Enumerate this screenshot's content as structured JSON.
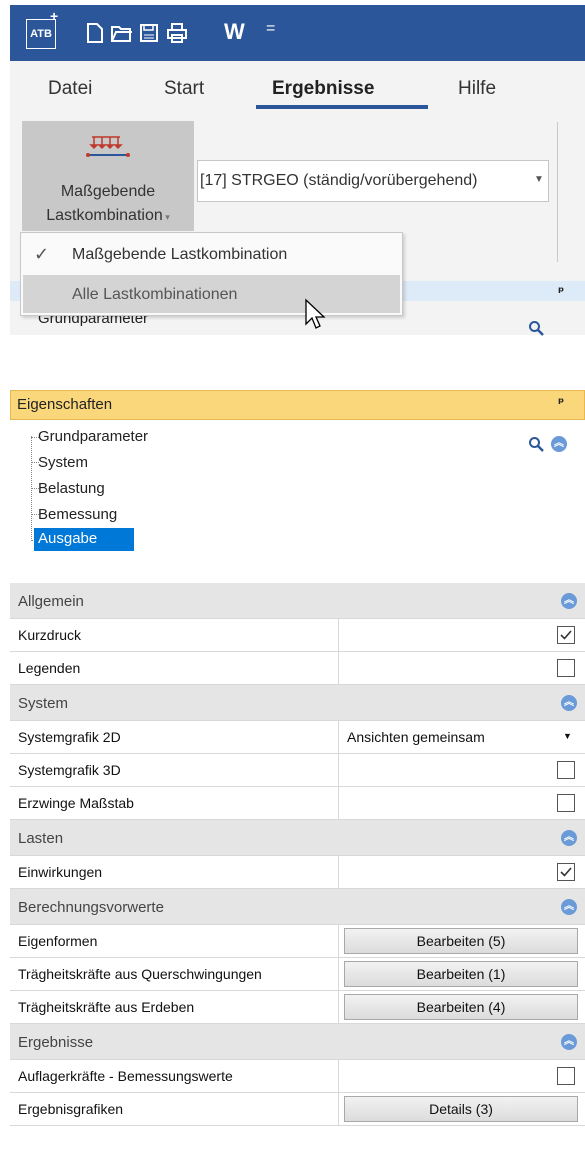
{
  "titlebar": {
    "logo": "ATB",
    "logo_plus": "+",
    "w_label": "W",
    "more": "="
  },
  "ribbon": {
    "tabs": [
      "Datei",
      "Start",
      "Ergebnisse",
      "Hilfe"
    ],
    "active_tab": "Ergebnisse",
    "big_button": {
      "line1": "Maßgebende",
      "line2": "Lastkombination"
    },
    "combo_value": "[17] STRGEO (ständig/vorübergehend)",
    "menu": {
      "items": [
        "Maßgebende Lastkombination",
        "Alle Lastkombinationen"
      ],
      "checked": "Maßgebende Lastkombination",
      "hovered": "Alle Lastkombinationen"
    },
    "peek_tree_item": "Grundparameter"
  },
  "properties": {
    "title": "Eigenschaften",
    "pin": "ᵖ",
    "tree": [
      "Grundparameter",
      "System",
      "Belastung",
      "Bemessung",
      "Ausgabe"
    ],
    "selected": "Ausgabe"
  },
  "grid": {
    "sections": [
      {
        "title": "Allgemein",
        "rows": [
          {
            "name": "Kurzdruck",
            "type": "checkbox",
            "checked": true
          },
          {
            "name": "Legenden",
            "type": "checkbox",
            "checked": false
          }
        ]
      },
      {
        "title": "System",
        "rows": [
          {
            "name": "Systemgrafik 2D",
            "type": "dropdown",
            "value": "Ansichten gemeinsam"
          },
          {
            "name": "Systemgrafik 3D",
            "type": "checkbox",
            "checked": false
          },
          {
            "name": "Erzwinge Maßstab",
            "type": "checkbox",
            "checked": false
          }
        ]
      },
      {
        "title": "Lasten",
        "rows": [
          {
            "name": "Einwirkungen",
            "type": "checkbox",
            "checked": true
          }
        ]
      },
      {
        "title": "Berechnungsvorwerte",
        "rows": [
          {
            "name": "Eigenformen",
            "type": "button",
            "value": "Bearbeiten (5)"
          },
          {
            "name": "Trägheitskräfte aus Querschwingungen",
            "type": "button",
            "value": "Bearbeiten (1)"
          },
          {
            "name": "Trägheitskräfte aus Erdeben",
            "type": "button",
            "value": "Bearbeiten (4)"
          }
        ]
      },
      {
        "title": "Ergebnisse",
        "rows": [
          {
            "name": "Auflagerkräfte - Bemessungswerte",
            "type": "checkbox",
            "checked": false
          },
          {
            "name": "Ergebnisgrafiken",
            "type": "button",
            "value": "Details (3)"
          }
        ]
      }
    ]
  },
  "colors": {
    "titlebar": "#2b579a",
    "accent": "#0078d7",
    "header_yellow": "#fbd77b"
  }
}
